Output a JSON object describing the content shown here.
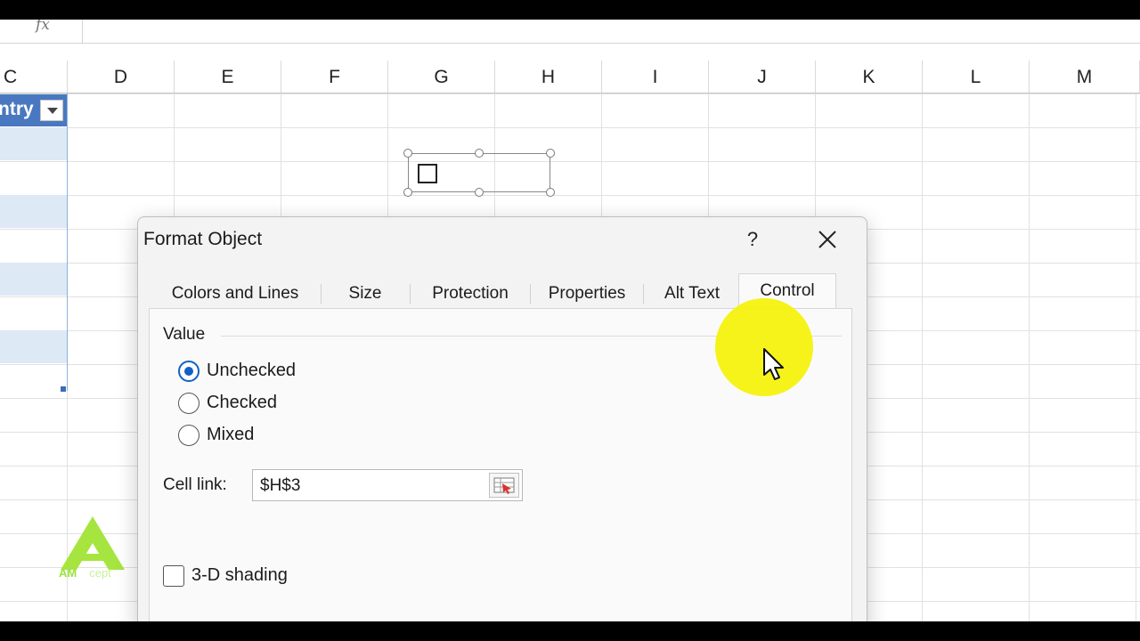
{
  "formula_bar": {
    "fx_label": "fx"
  },
  "columns": [
    "C",
    "D",
    "E",
    "F",
    "G",
    "H",
    "I",
    "J",
    "K",
    "L",
    "M"
  ],
  "table": {
    "header_fragment": "ntry"
  },
  "dialog": {
    "title": "Format Object",
    "help_label": "?",
    "tabs": [
      {
        "label": "Colors and Lines"
      },
      {
        "label": "Size"
      },
      {
        "label": "Protection"
      },
      {
        "label": "Properties"
      },
      {
        "label": "Alt Text"
      },
      {
        "label": "Control",
        "active": true
      }
    ],
    "value_group_label": "Value",
    "options": [
      {
        "label": "Unchecked",
        "selected": true
      },
      {
        "label": "Checked",
        "selected": false
      },
      {
        "label": "Mixed",
        "selected": false
      }
    ],
    "cell_link": {
      "label": "Cell link:",
      "value": "$H$3"
    },
    "shading": {
      "label": "3-D shading",
      "checked": false
    }
  },
  "watermark": {
    "brand": "AM",
    "suffix": "cept"
  },
  "colors": {
    "accent": "#0f62c4",
    "table_header": "#4a78c0",
    "band": "#dde9f5",
    "highlight": "#f5f20f"
  }
}
